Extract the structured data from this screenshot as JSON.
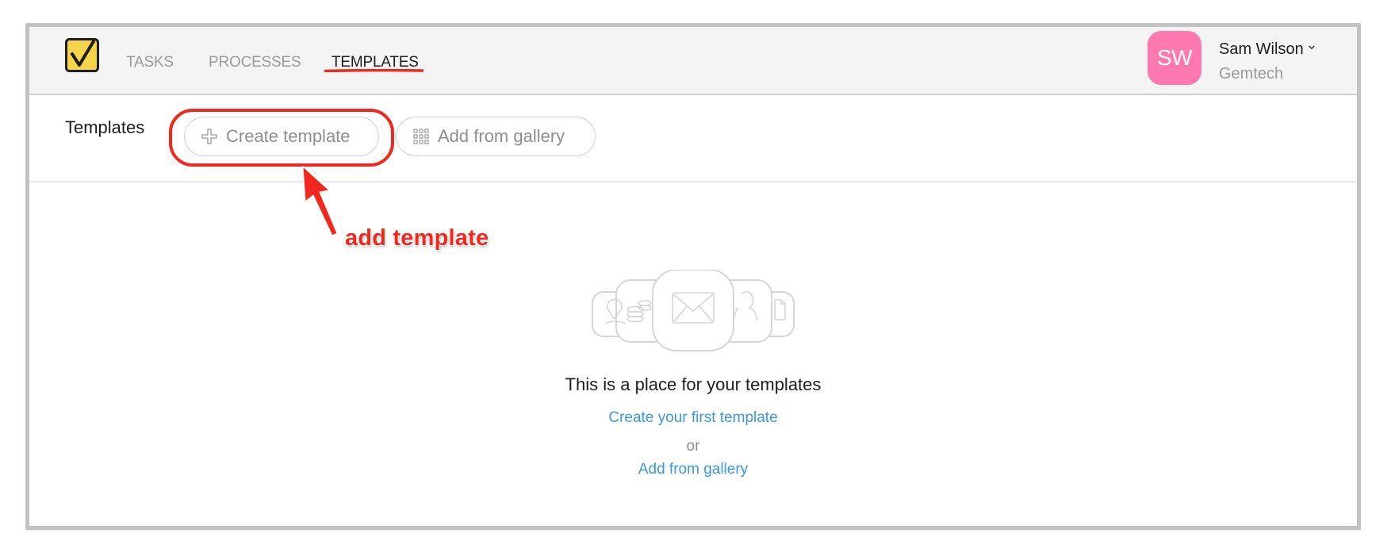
{
  "nav": {
    "items": [
      {
        "label": "TASKS",
        "active": false
      },
      {
        "label": "PROCESSES",
        "active": false
      },
      {
        "label": "TEMPLATES",
        "active": true
      }
    ],
    "logo_icon": "checkbox-check-icon"
  },
  "user": {
    "initials": "SW",
    "name": "Sam Wilson",
    "organization": "Gemtech",
    "avatar_color": "#ff78b0"
  },
  "toolbar": {
    "title": "Templates",
    "create_label": "Create template",
    "create_icon": "plus-icon",
    "gallery_label": "Add from gallery",
    "gallery_icon": "grid-icon"
  },
  "annotation": {
    "text": "add template",
    "color": "#f2271d"
  },
  "empty_state": {
    "title": "This is a place for your templates",
    "create_link": "Create your first template",
    "or_text": "or",
    "gallery_link": "Add from gallery",
    "illustration_icons": [
      "location-icon",
      "coins-icon",
      "envelope-icon",
      "user-icon",
      "document-icon"
    ]
  },
  "colors": {
    "link": "#3a97e6",
    "logo_fill": "#f7d54a",
    "header_bg": "#f4f4f4"
  }
}
